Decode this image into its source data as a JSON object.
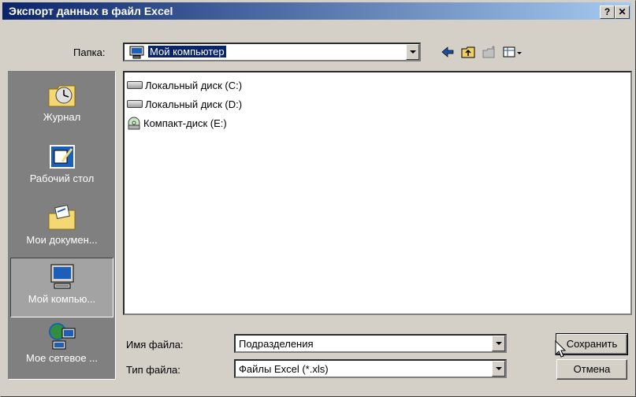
{
  "window": {
    "title": "Экспорт данных в файл Excel",
    "help_label": "?",
    "close_label": "✕"
  },
  "folder": {
    "label": "Папка:",
    "value": "Мой компьютер"
  },
  "toolbar": {
    "back_icon": "back-arrow-icon",
    "up_icon": "up-folder-icon",
    "new_folder_icon": "new-folder-icon",
    "view_icon": "view-menu-icon"
  },
  "places": [
    {
      "label": "Журнал",
      "icon": "history-icon"
    },
    {
      "label": "Рабочий стол",
      "icon": "desktop-icon"
    },
    {
      "label": "Мои докумен...",
      "icon": "my-documents-icon"
    },
    {
      "label": "Мой компью...",
      "icon": "my-computer-icon",
      "active": true
    },
    {
      "label": "Мое сетевое ...",
      "icon": "network-places-icon"
    }
  ],
  "files": [
    {
      "label": "Локальный диск (C:)",
      "icon": "hard-drive-icon"
    },
    {
      "label": "Локальный диск (D:)",
      "icon": "hard-drive-icon"
    },
    {
      "label": "Компакт-диск (E:)",
      "icon": "cd-drive-icon"
    }
  ],
  "filename": {
    "label": "Имя файла:",
    "value": "Подразделения"
  },
  "filetype": {
    "label": "Тип файла:",
    "value": "Файлы Excel (*.xls)"
  },
  "buttons": {
    "save": "Сохранить",
    "cancel": "Отмена"
  },
  "colors": {
    "titlebar_start": "#0a246a",
    "titlebar_end": "#a6caf0",
    "face": "#d4d0c8"
  }
}
